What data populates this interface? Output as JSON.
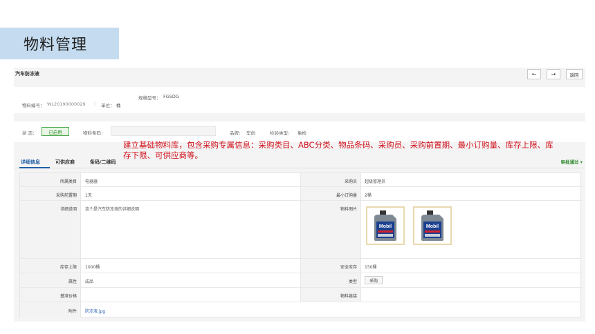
{
  "slide": {
    "title": "物料管理"
  },
  "header": {
    "page_name": "汽车防冻液",
    "back_icon": "←",
    "forward_icon": "→",
    "return_label": "返回"
  },
  "info": {
    "spec_label": "规格型号：",
    "spec_value": "FGSDG",
    "code_label": "物料编号：",
    "code_value": "WL20190000029",
    "unit_label": "单位：",
    "unit_value": "桶"
  },
  "status": {
    "status_label": "状 态：",
    "status_value": "已启用",
    "barcode_label": "物料条码：",
    "barcode_value": "",
    "brand_label": "品牌：",
    "brand_value": "华创",
    "inspect_label": "检验类型：",
    "inspect_value": "免检"
  },
  "annotation": "建立基础物料库，包含采购专属信息：采购类目、ABC分类、物品条码、采购员、采购前置期、最小订购量、库存上限、库存下限、可供应商等。",
  "tabs": [
    {
      "label": "详细信息",
      "active": true
    },
    {
      "label": "可供应商"
    },
    {
      "label": "条码/二维码"
    }
  ],
  "approve_label": "审批通过 ▾",
  "details": {
    "category_label": "所属类目",
    "category_value": "电器器",
    "buyer_label": "采购员",
    "buyer_value": "超级管理员",
    "lead_label": "采购前置期",
    "lead_value": "1天",
    "moq_label": "最小订购量",
    "moq_value": "2桶",
    "desc_label": "详细说明",
    "desc_value": "这个是汽车防冻液的详细说明",
    "photo_label": "物料图片",
    "photo_brand": "Mobil",
    "stock_max_label": "库存上限",
    "stock_max_value": "1000桶",
    "safety_label": "安全库存",
    "safety_value": "150桶",
    "attr_label": "属性",
    "attr_value": "成品",
    "type_label": "类型",
    "type_value": "采购",
    "price_label": "基准价格",
    "price_value": "",
    "link_label": "物料链接",
    "link_value": "",
    "attach_label": "附件",
    "attach_value": "防冻液.jpg"
  },
  "colors": {
    "accent": "#1f5fa6",
    "annotation": "#d0101b",
    "status": "#2e8b2e"
  }
}
